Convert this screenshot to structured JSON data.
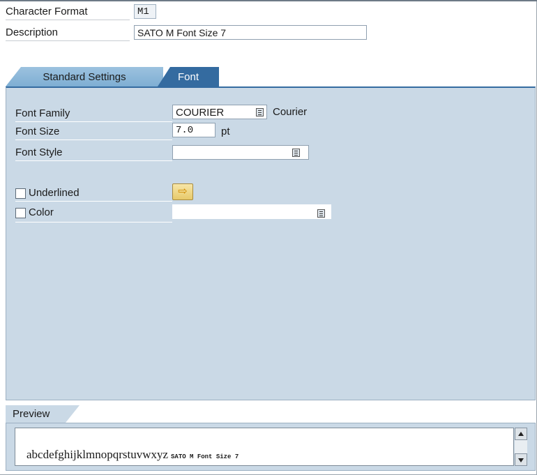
{
  "header": {
    "character_format_label": "Character Format",
    "character_format_value": "M1",
    "description_label": "Description",
    "description_value": "SATO M Font Size 7"
  },
  "tabs": [
    {
      "label": "Standard Settings",
      "active": false
    },
    {
      "label": "Font",
      "active": true
    }
  ],
  "font": {
    "family_label": "Font Family",
    "family_value": "COURIER",
    "family_name": "Courier",
    "size_label": "Font Size",
    "size_value": "7.0",
    "size_unit": "pt",
    "style_label": "Font Style",
    "style_value": "",
    "underlined_label": "Underlined",
    "underlined_checked": false,
    "color_label": "Color",
    "color_checked": false,
    "color_value": ""
  },
  "preview": {
    "tab_label": "Preview",
    "sample_text": "abcdefghijklmnopqrstuvwxyz",
    "sample_small": "SATO M Font Size 7"
  },
  "colors": {
    "panel_bg": "#cad9e6",
    "active_tab": "#346ba0",
    "inactive_tab": "#8db8da"
  }
}
